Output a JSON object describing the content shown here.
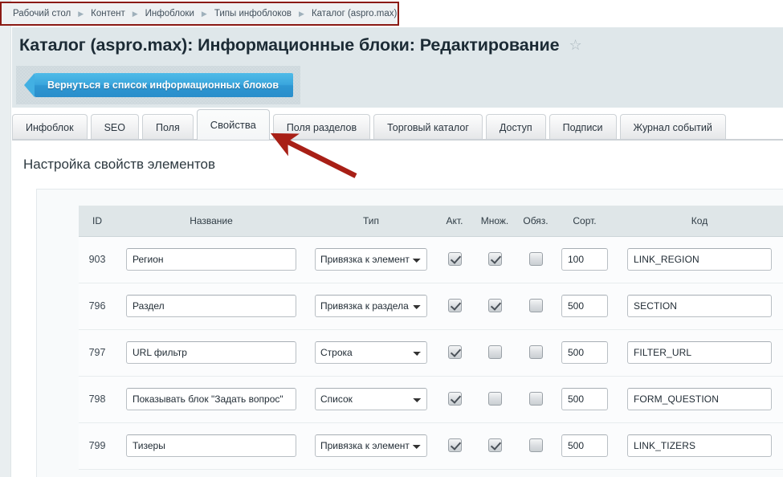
{
  "breadcrumb": {
    "separator": "▶",
    "items": [
      {
        "label": "Рабочий стол"
      },
      {
        "label": "Контент"
      },
      {
        "label": "Инфоблоки"
      },
      {
        "label": "Типы инфоблоков"
      },
      {
        "label": "Каталог (aspro.max)"
      }
    ]
  },
  "header": {
    "title": "Каталог (aspro.max): Информационные блоки: Редактирование",
    "favorite_icon": "☆"
  },
  "toolbar": {
    "back_label": "Вернуться в список информационных блоков"
  },
  "tabs": [
    {
      "label": "Инфоблок",
      "active": false
    },
    {
      "label": "SEO",
      "active": false
    },
    {
      "label": "Поля",
      "active": false
    },
    {
      "label": "Свойства",
      "active": true
    },
    {
      "label": "Поля разделов",
      "active": false
    },
    {
      "label": "Торговый каталог",
      "active": false
    },
    {
      "label": "Доступ",
      "active": false
    },
    {
      "label": "Подписи",
      "active": false
    },
    {
      "label": "Журнал событий",
      "active": false
    }
  ],
  "main": {
    "section_heading": "Настройка свойств элементов",
    "columns": [
      {
        "key": "id",
        "label": "ID"
      },
      {
        "key": "name",
        "label": "Название"
      },
      {
        "key": "type",
        "label": "Тип"
      },
      {
        "key": "act",
        "label": "Акт."
      },
      {
        "key": "mult",
        "label": "Множ."
      },
      {
        "key": "req",
        "label": "Обяз."
      },
      {
        "key": "sort",
        "label": "Сорт."
      },
      {
        "key": "code",
        "label": "Код"
      }
    ],
    "rows": [
      {
        "id": "903",
        "name": "Регион",
        "type": "Привязка к элемент",
        "act": true,
        "mult": true,
        "req": false,
        "sort": "100",
        "code": "LINK_REGION"
      },
      {
        "id": "796",
        "name": "Раздел",
        "type": "Привязка к раздела",
        "act": true,
        "mult": true,
        "req": false,
        "sort": "500",
        "code": "SECTION"
      },
      {
        "id": "797",
        "name": "URL фильтр",
        "type": "Строка",
        "act": true,
        "mult": false,
        "req": false,
        "sort": "500",
        "code": "FILTER_URL"
      },
      {
        "id": "798",
        "name": "Показывать блок \"Задать вопрос\"",
        "type": "Список",
        "act": true,
        "mult": false,
        "req": false,
        "sort": "500",
        "code": "FORM_QUESTION"
      },
      {
        "id": "799",
        "name": "Тизеры",
        "type": "Привязка к элемент",
        "act": true,
        "mult": true,
        "req": false,
        "sort": "500",
        "code": "LINK_TIZERS"
      }
    ]
  },
  "annotation": {
    "arrow_color": "#a81f16",
    "points_to": "tab-svoystva"
  },
  "colors": {
    "breadcrumb_border": "#8b1a14",
    "title_band": "#dfe7ea",
    "button_blue": "#35a3da",
    "table_header": "#dfe6e8"
  }
}
